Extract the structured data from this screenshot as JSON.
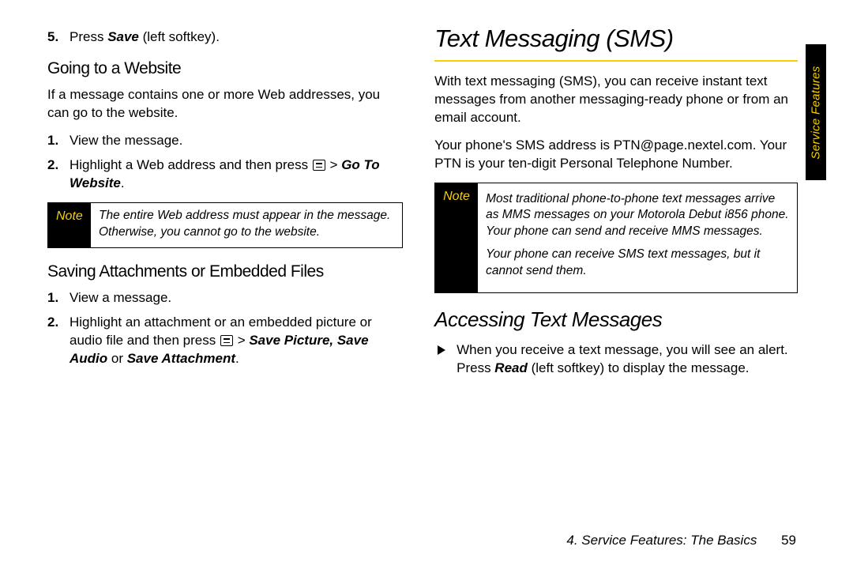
{
  "sideTab": "Service Features",
  "footer": {
    "chapter": "4. Service Features: The Basics",
    "pageNumber": "59"
  },
  "left": {
    "step5_pre": "Press ",
    "step5_b": "Save",
    "step5_post": " (left softkey).",
    "h3a": "Going to a Website",
    "p1": "If a message contains one or more Web addresses, you can go to the website.",
    "s1": "View the message.",
    "s2_pre": "Highlight a Web address and then press ",
    "s2_gt": " > ",
    "s2_b": "Go To Website",
    "note_label": "Note",
    "note_text": "The entire Web address must appear in the message. Otherwise, you cannot go to the website.",
    "h3b": "Saving Attachments or Embedded Files",
    "sb1": "View a message.",
    "sb2_pre": "Highlight an attachment or an embedded picture or audio file and then press ",
    "sb2_gt": " > ",
    "sb2_b": "Save Picture, Save Audio",
    "sb2_mid": " or ",
    "sb2_b2": "Save Attachment",
    "sb2_post": "."
  },
  "right": {
    "h1": "Text Messaging (SMS)",
    "p1": "With text messaging (SMS), you can receive instant text messages from another messaging-ready phone or from an email account.",
    "p2": "Your phone's SMS address is PTN@page.nextel.com. Your PTN is your ten-digit Personal Telephone Number.",
    "note_label": "Note",
    "note_p1": "Most traditional phone-to-phone text messages arrive as MMS messages on your Motorola Debut i856 phone. Your phone can send and receive MMS messages.",
    "note_p2": "Your phone can receive SMS text messages, but it cannot send them.",
    "h2": "Accessing Text Messages",
    "b1_pre": "When you receive a text message, you will see an alert. Press ",
    "b1_b": "Read",
    "b1_post": " (left softkey) to display the message."
  }
}
